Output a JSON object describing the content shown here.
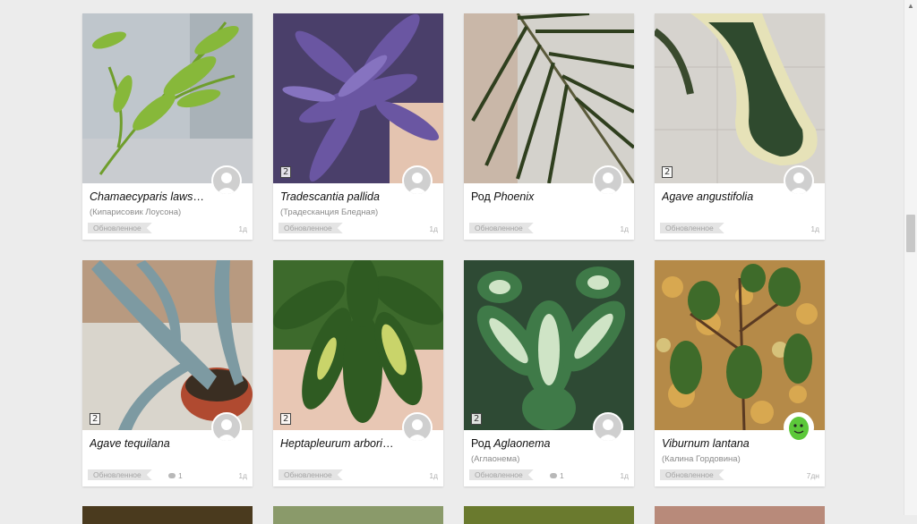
{
  "cards": [
    {
      "title_prefix": "",
      "title_latin": "Chamaecyparis lawsoni...",
      "subtitle": "(Кипарисовик Лоусона)",
      "tag": "Обновленное",
      "comments": "",
      "age": "1д",
      "photo_count": "",
      "photo_icon": "conifer-photo"
    },
    {
      "title_prefix": "",
      "title_latin": "Tradescantia pallida",
      "subtitle": "(Традесканция Бледная)",
      "tag": "Обновленное",
      "comments": "",
      "age": "1д",
      "photo_count": "2",
      "photo_icon": "purple-leaf-photo"
    },
    {
      "title_prefix": "Род ",
      "title_latin": "Phoenix",
      "subtitle": "",
      "tag": "Обновленное",
      "comments": "",
      "age": "1д",
      "photo_count": "",
      "photo_icon": "palm-photo"
    },
    {
      "title_prefix": "",
      "title_latin": "Agave angustifolia",
      "subtitle": "",
      "tag": "Обновленное",
      "comments": "",
      "age": "1д",
      "photo_count": "2",
      "photo_icon": "agave-photo"
    },
    {
      "title_prefix": "",
      "title_latin": "Agave tequilana",
      "subtitle": "",
      "tag": "Обновленное",
      "comments": "1",
      "age": "1д",
      "photo_count": "2",
      "photo_icon": "blue-agave-photo"
    },
    {
      "title_prefix": "",
      "title_latin": "Heptapleurum arboricola",
      "subtitle": "",
      "tag": "Обновленное",
      "comments": "",
      "age": "1д",
      "photo_count": "2",
      "photo_icon": "schefflera-photo"
    },
    {
      "title_prefix": "Род ",
      "title_latin": "Aglaonema",
      "subtitle": "(Аглаонема)",
      "tag": "Обновленное",
      "comments": "1",
      "age": "1д",
      "photo_count": "2",
      "photo_icon": "aglaonema-photo"
    },
    {
      "title_prefix": "",
      "title_latin": "Viburnum lantana",
      "subtitle": "(Калина Гордовина)",
      "tag": "Обновленное",
      "comments": "",
      "age": "7дн",
      "photo_count": "",
      "photo_icon": "viburnum-photo"
    }
  ],
  "colors": {
    "background": "#ececec",
    "card": "#ffffff",
    "tag_bg": "#e4e4e4"
  }
}
